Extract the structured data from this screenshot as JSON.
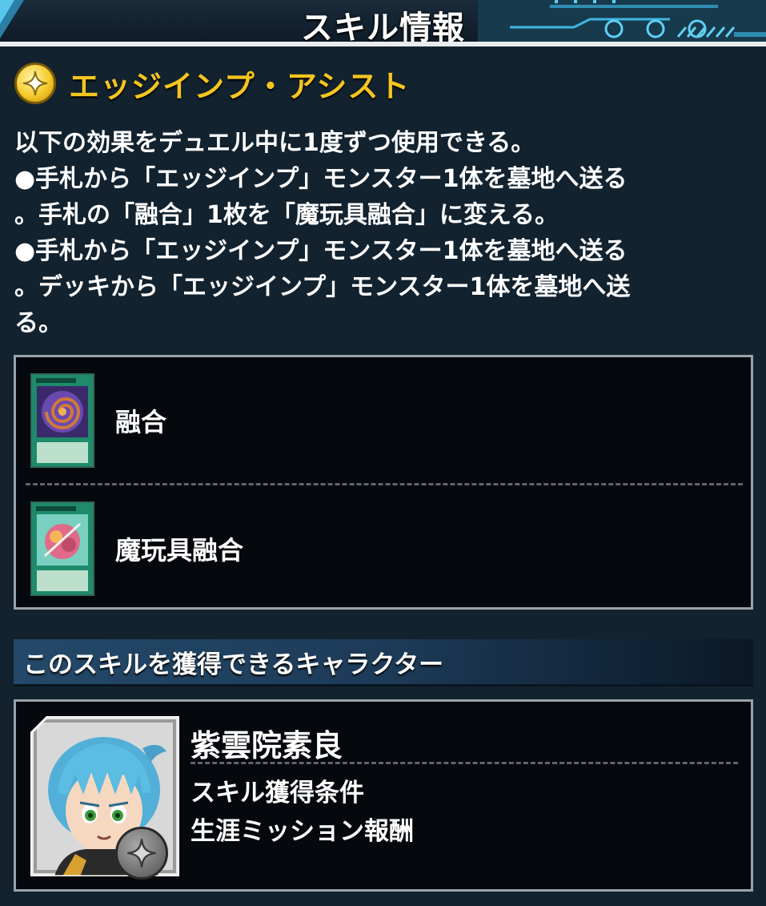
{
  "header": {
    "title": "スキル情報"
  },
  "skill": {
    "name": "エッジインプ・アシスト",
    "icon": "sparkle-icon",
    "description_lines": [
      "以下の効果をデュエル中に1度ずつ使用できる。",
      "●手札から「エッジインプ」モンスター1体を墓地へ送る",
      "。手札の「融合」1枚を「魔玩具融合」に変える。",
      "●手札から「エッジインプ」モンスター1体を墓地へ送る",
      "。デッキから「エッジインプ」モンスター1体を墓地へ送",
      "る。"
    ]
  },
  "related_cards": [
    {
      "name": "融合",
      "art_color": "#8a6ad0"
    },
    {
      "name": "魔玩具融合",
      "art_color": "#e06a8a"
    }
  ],
  "section": {
    "title": "このスキルを獲得できるキャラクター"
  },
  "character": {
    "name": "紫雲院素良",
    "condition_title": "スキル獲得条件",
    "condition_value": "生涯ミッション報酬",
    "badge_icon": "sparkle-icon"
  },
  "colors": {
    "accent_gold": "#f4c51f",
    "card_spell_green": "#1f8a6c",
    "panel_bg": "#13222f"
  }
}
